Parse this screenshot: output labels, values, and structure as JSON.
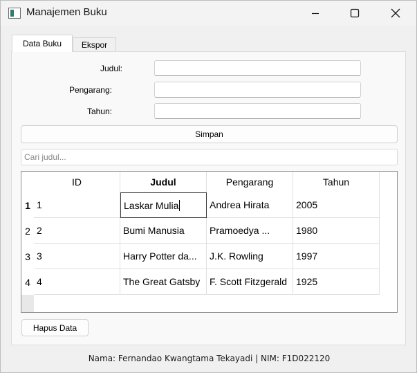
{
  "window": {
    "title": "Manajemen Buku",
    "icon": "app-window-icon",
    "controls": [
      "minimize-icon",
      "maximize-icon",
      "close-icon"
    ]
  },
  "tabs": [
    {
      "label": "Data Buku",
      "active": true
    },
    {
      "label": "Ekspor",
      "active": false
    }
  ],
  "form": {
    "judul_label": "Judul:",
    "pengarang_label": "Pengarang:",
    "tahun_label": "Tahun:",
    "judul_value": "",
    "pengarang_value": "",
    "tahun_value": ""
  },
  "buttons": {
    "save_label": "Simpan",
    "delete_label": "Hapus Data"
  },
  "search": {
    "placeholder": "Cari judul..."
  },
  "table": {
    "headers": [
      "ID",
      "Judul",
      "Pengarang",
      "Tahun"
    ],
    "row_headers": [
      "1",
      "2",
      "3",
      "4"
    ],
    "rows": [
      [
        "1",
        "Laskar Mulia",
        "Andrea Hirata",
        "2005"
      ],
      [
        "2",
        "Bumi Manusia",
        "Pramoedya ...",
        "1980"
      ],
      [
        "3",
        "Harry Potter da...",
        "J.K. Rowling",
        "1997"
      ],
      [
        "4",
        "The Great Gatsby",
        "F. Scott Fitzgerald",
        "1925"
      ]
    ]
  },
  "footer": {
    "text": "Nama: Fernandao Kwangtama Tekayadi | NIM: F1D022120"
  }
}
